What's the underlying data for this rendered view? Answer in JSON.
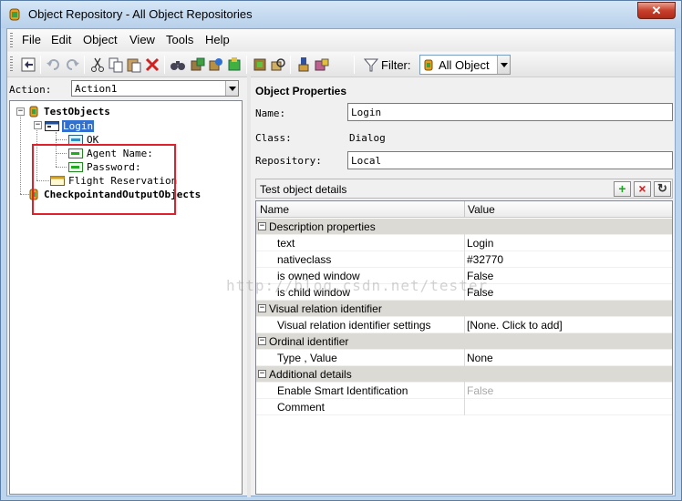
{
  "window": {
    "title": "Object Repository - All Object Repositories",
    "close_glyph": "✕"
  },
  "menu": [
    "File",
    "Edit",
    "Object",
    "View",
    "Tools",
    "Help"
  ],
  "toolbar": {
    "icons": [
      "navigate-up-icon",
      "undo-icon",
      "redo-icon",
      "cut-icon",
      "copy-icon",
      "paste-icon",
      "delete-icon",
      "find-icon",
      "add-objects-icon",
      "update-icon",
      "export-icon",
      "highlight-icon",
      "locate-icon",
      "object-spy-icon",
      "define-object-icon"
    ],
    "filter_label": "Filter:",
    "filter_value": "All Object"
  },
  "action": {
    "label": "Action:",
    "value": "Action1"
  },
  "tree": {
    "root": "TestObjects",
    "dialog": "Login",
    "children": [
      "OK",
      "Agent Name:",
      "Password:"
    ],
    "sibling": "Flight Reservation",
    "checkpoint": "CheckpointandOutputObjects",
    "expand_glyph": "−"
  },
  "properties": {
    "title": "Object Properties",
    "name_label": "Name:",
    "name_value": "Login",
    "class_label": "Class:",
    "class_value": "Dialog",
    "repository_label": "Repository:",
    "repository_value": "Local"
  },
  "details": {
    "label": "Test object details",
    "add_glyph": "+",
    "remove_glyph": "×",
    "refresh_glyph": "↻",
    "col_name": "Name",
    "col_value": "Value",
    "rows": [
      {
        "cat": true,
        "name": "Description properties",
        "value": ""
      },
      {
        "cat": false,
        "name": "text",
        "value": "Login"
      },
      {
        "cat": false,
        "name": "nativeclass",
        "value": "#32770"
      },
      {
        "cat": false,
        "name": "is owned window",
        "value": "False"
      },
      {
        "cat": false,
        "name": "is child window",
        "value": "False"
      },
      {
        "cat": true,
        "name": "Visual relation identifier",
        "value": ""
      },
      {
        "cat": false,
        "name": "Visual relation identifier settings",
        "value": "[None. Click to add]"
      },
      {
        "cat": true,
        "name": "Ordinal identifier",
        "value": ""
      },
      {
        "cat": false,
        "name": "Type , Value",
        "value": "None"
      },
      {
        "cat": true,
        "name": "Additional details",
        "value": ""
      },
      {
        "cat": false,
        "name": "Enable Smart Identification",
        "value": "False",
        "disabled": true
      },
      {
        "cat": false,
        "name": "Comment",
        "value": ""
      }
    ]
  },
  "watermark": "http://blog.csdn.net/tester"
}
